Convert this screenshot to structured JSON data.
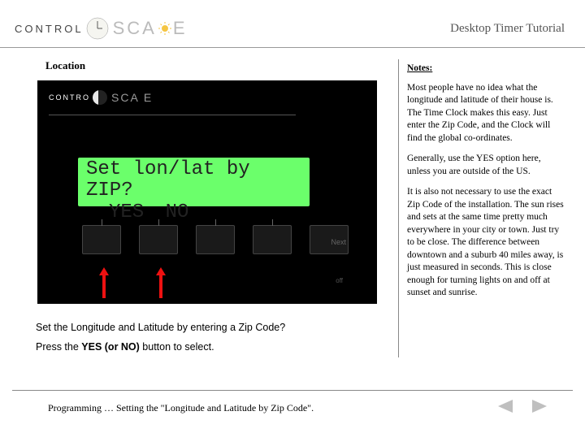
{
  "header": {
    "logo_control": "CONTROL",
    "logo_scape_pre": "SCA",
    "logo_scape_post": "E",
    "title": "Desktop Timer Tutorial"
  },
  "left": {
    "location_label": "Location",
    "device": {
      "logo_control": "CONTRO",
      "logo_scape": "SCA   E",
      "lcd_line1": "Set lon/lat by ZIP?",
      "lcd_yes": "YES",
      "lcd_no": "NO",
      "btn_next": "Next",
      "btn_off": "off"
    },
    "caption_line1": "Set the Longitude and Latitude by entering a Zip Code?",
    "caption_prefix": "Press the ",
    "caption_bold": "YES (or NO)",
    "caption_suffix": " button to select."
  },
  "notes": {
    "heading": "Notes:",
    "p1": "Most people have no idea what the longitude and latitude of their house is. The Time Clock makes this easy. Just enter the Zip Code, and the Clock will find the global co-ordinates.",
    "p2": "Generally, use the YES option here, unless you are outside of the US.",
    "p3": "It is also not necessary to use the exact Zip Code of the installation. The sun rises and sets at the same time pretty much everywhere in your city or town. Just try to be close. The difference between downtown and a suburb 40 miles away, is just measured in seconds. This is close enough for turning lights on and off at sunset and sunrise."
  },
  "footer": {
    "text": "Programming … Setting the \"Longitude and Latitude by Zip Code\"."
  }
}
